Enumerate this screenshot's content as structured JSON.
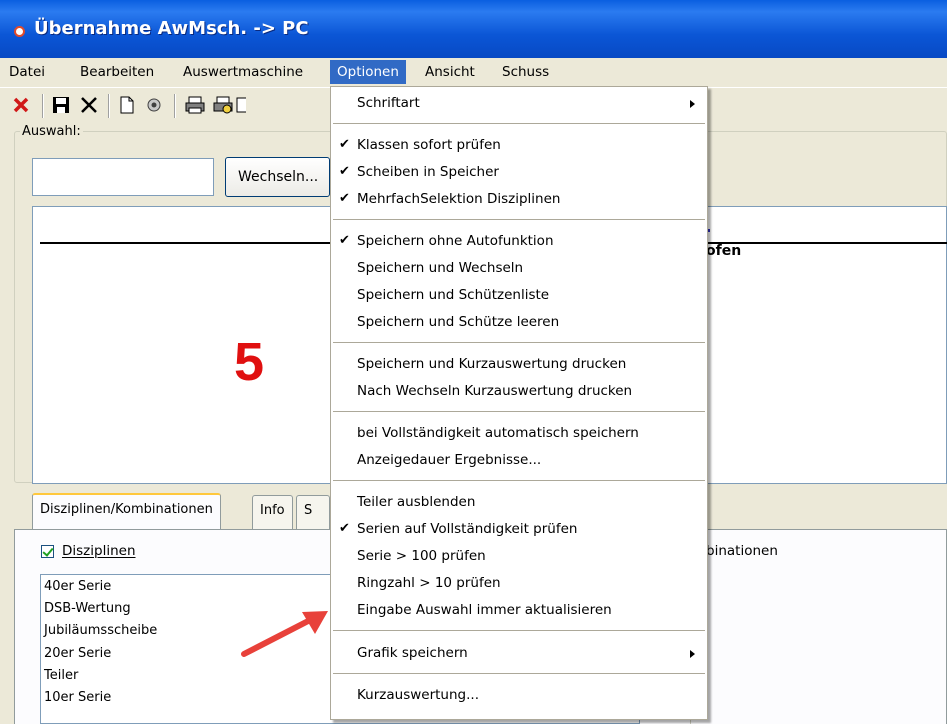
{
  "window": {
    "title": "Übernahme AwMsch. -> PC"
  },
  "menubar": {
    "items": [
      "Datei",
      "Bearbeiten",
      "Auswertmaschine",
      "Optionen",
      "Ansicht",
      "Schuss"
    ],
    "active": "Optionen"
  },
  "auswahl": {
    "label": "Auswahl:",
    "input_value": "",
    "button_label": "Wechseln..."
  },
  "display": {
    "big_number": "5",
    "right_text": "ofen"
  },
  "tabs": [
    "Disziplinen/Kombinationen",
    "Info",
    "S"
  ],
  "disziplinen": {
    "checkbox_label": "Disziplinen",
    "checked": true,
    "items": [
      "40er Serie",
      "DSB-Wertung",
      "Jubiläumsscheibe",
      "20er Serie",
      "Teiler",
      "10er Serie"
    ]
  },
  "kombinationen_label": "binationen",
  "dropdown": {
    "items": [
      {
        "label": "Schriftart",
        "checked": false,
        "submenu": true
      },
      {
        "label": "Klassen sofort prüfen",
        "checked": true,
        "submenu": false
      },
      {
        "label": "Scheiben in Speicher",
        "checked": true,
        "submenu": false
      },
      {
        "label": "MehrfachSelektion Disziplinen",
        "checked": true,
        "submenu": false
      },
      {
        "label": "Speichern ohne Autofunktion",
        "checked": true,
        "submenu": false
      },
      {
        "label": "Speichern und Wechseln",
        "checked": false,
        "submenu": false
      },
      {
        "label": "Speichern und Schützenliste",
        "checked": false,
        "submenu": false
      },
      {
        "label": "Speichern und Schütze leeren",
        "checked": false,
        "submenu": false
      },
      {
        "label": "Speichern und Kurzauswertung drucken",
        "checked": false,
        "submenu": false
      },
      {
        "label": "Nach Wechseln Kurzauswertung drucken",
        "checked": false,
        "submenu": false
      },
      {
        "label": "bei Vollständigkeit automatisch speichern",
        "checked": false,
        "submenu": false
      },
      {
        "label": "Anzeigedauer Ergebnisse...",
        "checked": false,
        "submenu": false
      },
      {
        "label": "Teiler ausblenden",
        "checked": false,
        "submenu": false
      },
      {
        "label": "Serien auf Vollständigkeit prüfen",
        "checked": true,
        "submenu": false
      },
      {
        "label": "Serie > 100 prüfen",
        "checked": false,
        "submenu": false
      },
      {
        "label": "Ringzahl > 10 prüfen",
        "checked": false,
        "submenu": false
      },
      {
        "label": "Eingabe Auswahl immer aktualisieren",
        "checked": false,
        "submenu": false
      },
      {
        "label": "Grafik speichern",
        "checked": false,
        "submenu": true
      },
      {
        "label": "Kurzauswertung...",
        "checked": false,
        "submenu": false
      }
    ]
  },
  "colors": {
    "titlebar": "#0b56d6",
    "menu_highlight": "#316ac5",
    "big_number": "#e01010",
    "arrow": "#e8413a"
  }
}
